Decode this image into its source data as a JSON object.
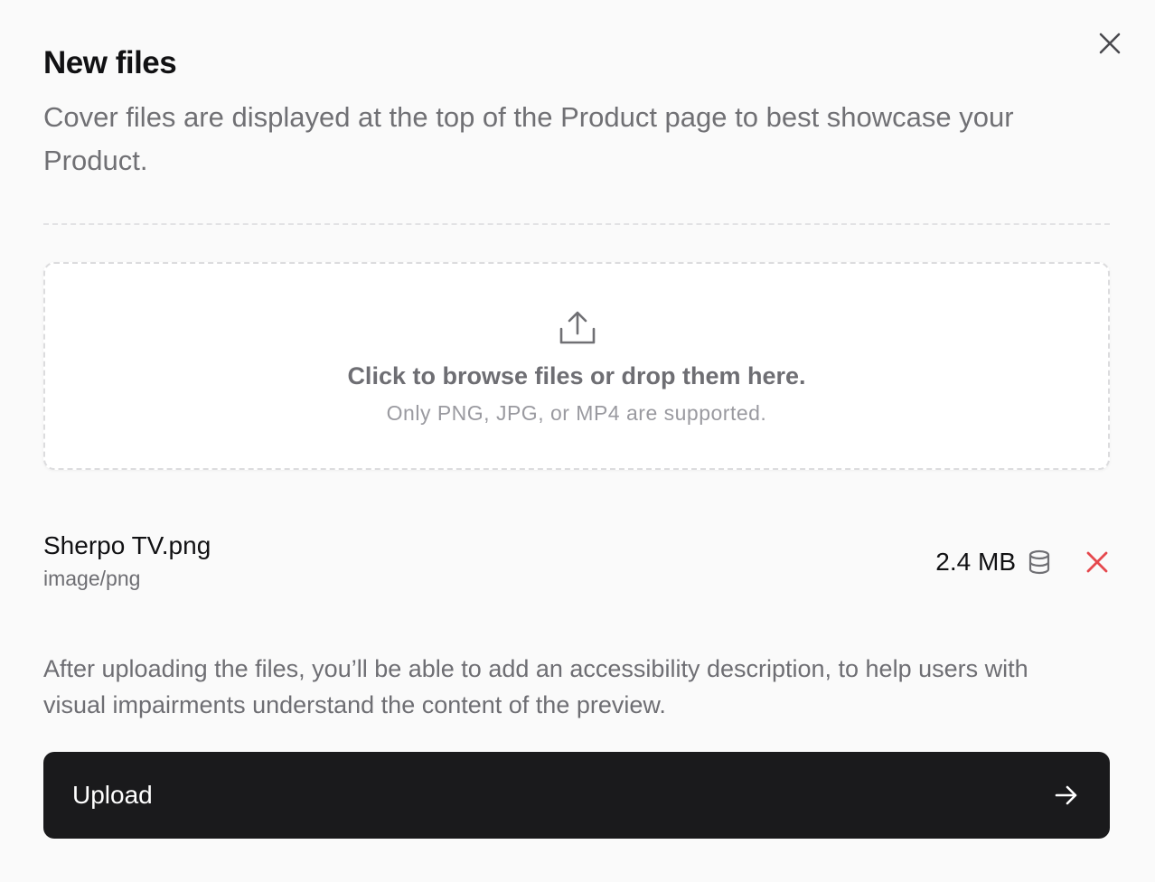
{
  "modal": {
    "title": "New files",
    "subtitle": "Cover files are displayed at the top of the Product page to best showcase your Product."
  },
  "dropzone": {
    "main_text": "Click to browse files or drop them here.",
    "sub_text": "Only PNG, JPG, or MP4 are supported.",
    "icon": "upload-icon"
  },
  "files": [
    {
      "name": "Sherpo TV.png",
      "type": "image/png",
      "size": "2.4 MB"
    }
  ],
  "help_text": "After uploading the files, you’ll be able to add an accessibility description, to help users with visual impairments understand the content of the preview.",
  "upload_button": {
    "label": "Upload",
    "icon": "arrow-right-icon"
  },
  "colors": {
    "background": "#FAFAFA",
    "primary_button": "#1A1A1C",
    "remove": "#E5484D",
    "muted_text": "#6E6E73"
  }
}
